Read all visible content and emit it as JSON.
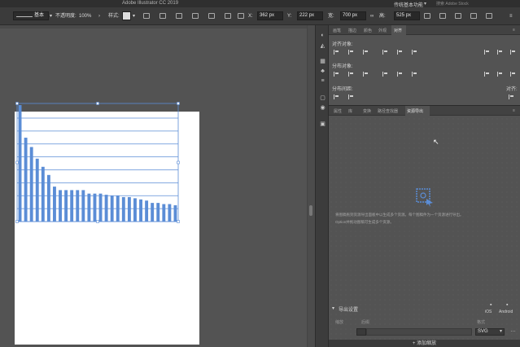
{
  "app": {
    "title": "Adobe Illustrator CC 2019",
    "workspace": "传统基本功能",
    "search_placeholder": "搜索 Adobe Stock"
  },
  "control_bar": {
    "stroke_label": "基本",
    "opacity_label": "不透明度:",
    "opacity_value": "100%",
    "style_label": "样式:",
    "x_label": "X:",
    "x_value": "362 px",
    "y_label": "Y:",
    "y_value": "222 px",
    "w_label": "宽:",
    "w_value": "700 px",
    "h_label": "高:",
    "h_value": "525 px"
  },
  "align_panel": {
    "tabs": [
      "画笔",
      "描边",
      "颜色",
      "外观",
      "对齐"
    ],
    "active_tab": "对齐",
    "align_objects": "对齐对象:",
    "distribute_objects": "分布对象:",
    "distribute_spacing": "分布间距:",
    "align_to": "对齐:"
  },
  "export_panel": {
    "tabs": [
      "属性",
      "库",
      "变换",
      "路径查找器",
      "资源导出"
    ],
    "active_tab": "资源导出",
    "message_line1": "将图稿拖到资源导出面板中以生成多个资源。每个图稿件为一个资源进行导出。",
    "message_line2": "Option并拖动图稿可生成多个资源。",
    "export_settings": "导出设置",
    "platform_ios": "iOS",
    "platform_android": "Android",
    "col_scale": "缩放",
    "col_suffix": "后缀",
    "col_format": "格式",
    "format_value": "SVG",
    "add_scale": "+ 添加缩放"
  },
  "chart_data": {
    "type": "bar",
    "values": [
      100,
      72,
      64,
      54,
      47,
      40,
      30,
      27,
      27,
      27,
      27,
      27,
      24,
      24,
      24,
      23,
      22,
      22,
      21,
      21,
      20,
      19,
      18,
      16,
      16,
      15,
      15,
      14
    ],
    "gridlines": 9,
    "grid": true,
    "color": "#5b8dd6",
    "selection_color": "#5b8dd6"
  }
}
